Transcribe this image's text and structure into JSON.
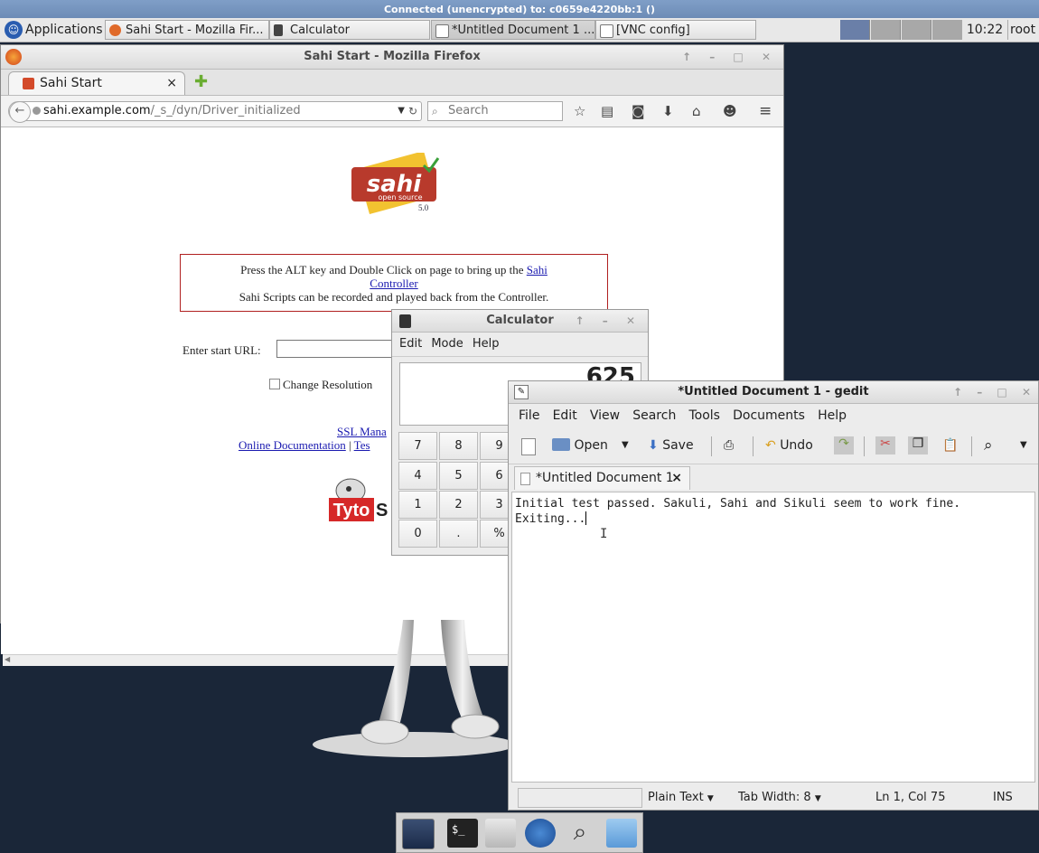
{
  "vnc": {
    "title": "Connected (unencrypted) to: c0659e4220bb:1 ()"
  },
  "taskbar": {
    "applications_label": "Applications",
    "tasks": [
      "Sahi Start - Mozilla Fir...",
      "Calculator",
      "*Untitled Document 1 ...",
      "[VNC config]"
    ],
    "clock": "10:22",
    "user": "root"
  },
  "firefox": {
    "title": "Sahi Start - Mozilla Firefox",
    "tab_label": "Sahi Start",
    "url_host": "sahi.example.com",
    "url_path": "/_s_/dyn/Driver_initialized",
    "search_placeholder": "Search",
    "page": {
      "logo_text": "sahi",
      "logo_sub": "open source",
      "logo_version": "5.0",
      "info_line1": "Press the ALT key and Double Click on page to bring up the",
      "info_link_a": "Sahi",
      "info_link_b": "Controller",
      "info_line2": "Sahi Scripts can be recorded and played back from the Controller.",
      "start_url_label": "Enter start URL:",
      "change_resolution_label": "Change Resolution",
      "ssl_link": "SSL Mana",
      "docs_link": "Online Documentation",
      "links_sep": "|",
      "test_link": "Tes",
      "tyto_label": "Tyto",
      "tyto_partial": "S"
    }
  },
  "calculator": {
    "title": "Calculator",
    "menu": [
      "Edit",
      "Mode",
      "Help"
    ],
    "display_value": "625",
    "keys": [
      "7",
      "8",
      "9",
      "4",
      "5",
      "6",
      "1",
      "2",
      "3",
      "0",
      ".",
      "%"
    ]
  },
  "gedit": {
    "title": "*Untitled Document 1 - gedit",
    "menu": [
      "File",
      "Edit",
      "View",
      "Search",
      "Tools",
      "Documents",
      "Help"
    ],
    "toolbar": {
      "open_label": "Open",
      "save_label": "Save",
      "undo_label": "Undo"
    },
    "tab_label": "*Untitled Document 1",
    "text_line1": "Initial test passed. Sakuli, Sahi and Sikuli seem to work fine.",
    "text_line2": "Exiting...",
    "status": {
      "language": "Plain Text",
      "tab_width": "Tab Width: 8",
      "position": "Ln 1, Col 75",
      "mode": "INS"
    }
  }
}
